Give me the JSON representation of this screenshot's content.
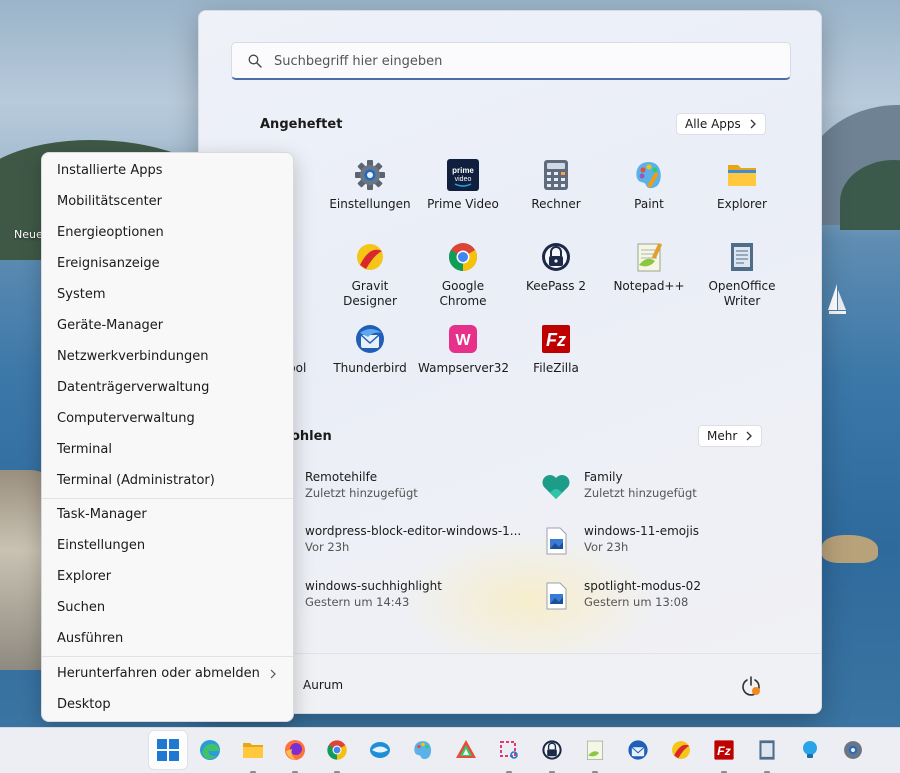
{
  "desktop": {
    "icon_label": "Neue"
  },
  "start_menu": {
    "search": {
      "placeholder": "Suchbegriff hier eingeben"
    },
    "pinned": {
      "title": "Angeheftet",
      "all_apps_label": "Alle Apps",
      "apps": [
        {
          "label": "Einstellungen",
          "icon": "gear-icon"
        },
        {
          "label": "Prime Video",
          "icon": "prime-video-icon"
        },
        {
          "label": "Rechner",
          "icon": "calculator-icon"
        },
        {
          "label": "Paint",
          "icon": "paint-icon"
        },
        {
          "label": "Explorer",
          "icon": "folder-icon"
        },
        {
          "label": "Gravit Designer",
          "icon": "gravit-designer-icon"
        },
        {
          "label": "Google Chrome",
          "icon": "chrome-icon"
        },
        {
          "label": "KeePass 2",
          "icon": "keepass-icon"
        },
        {
          "label": "Notepad++",
          "icon": "notepad-plus-plus-icon"
        },
        {
          "label": "OpenOffice Writer",
          "icon": "openoffice-writer-icon"
        },
        {
          "label": "Thunderbird",
          "icon": "thunderbird-icon"
        },
        {
          "label": "Wampserver32",
          "icon": "wampserver-icon"
        },
        {
          "label": "FileZilla",
          "icon": "filezilla-icon"
        }
      ],
      "partial_labels": [
        "Tool"
      ]
    },
    "recommended": {
      "title_partial": "ohlen",
      "more_label": "Mehr",
      "items": [
        {
          "name": "Remotehilfe",
          "meta": "Zuletzt hinzugefügt",
          "icon": "remote-help-icon"
        },
        {
          "name": "Family",
          "meta": "Zuletzt hinzugefügt",
          "icon": "family-heart-icon"
        },
        {
          "name": "wordpress-block-editor-windows-1...",
          "meta": "Vor 23h",
          "icon": "image-file-icon"
        },
        {
          "name": "windows-11-emojis",
          "meta": "Vor 23h",
          "icon": "image-file-icon"
        },
        {
          "name": "windows-suchhighlight",
          "meta": "Gestern um 14:43",
          "icon": "image-file-icon"
        },
        {
          "name": "spotlight-modus-02",
          "meta": "Gestern um 13:08",
          "icon": "image-file-icon"
        }
      ]
    },
    "footer": {
      "user_name": "Aurum"
    }
  },
  "context_menu": {
    "items": [
      "Installierte Apps",
      "Mobilitätscenter",
      "Energieoptionen",
      "Ereignisanzeige",
      "System",
      "Geräte-Manager",
      "Netzwerkverbindungen",
      "Datenträgerverwaltung",
      "Computerverwaltung",
      "Terminal",
      "Terminal (Administrator)",
      "Task-Manager",
      "Einstellungen",
      "Explorer",
      "Suchen",
      "Ausführen",
      "Herunterfahren oder abmelden",
      "Desktop"
    ]
  },
  "taskbar": {
    "icons": [
      "windows-start-icon",
      "edge-icon",
      "file-explorer-icon",
      "firefox-icon",
      "chrome-icon",
      "thunderbird-icon",
      "paint-icon",
      "gravit-icon",
      "snipping-tool-icon",
      "keepass-icon",
      "notepad-plus-plus-icon",
      "thunderbird-alt-icon",
      "gravit-designer-icon",
      "filezilla-icon",
      "openoffice-writer-icon",
      "tips-bulb-icon",
      "settings-gear-icon"
    ]
  },
  "colors": {
    "accent": "#4a6fa5",
    "start_bg": "#eef1f8",
    "context_bg": "#f8f8f9",
    "taskbar_bg": "#eceef3"
  }
}
